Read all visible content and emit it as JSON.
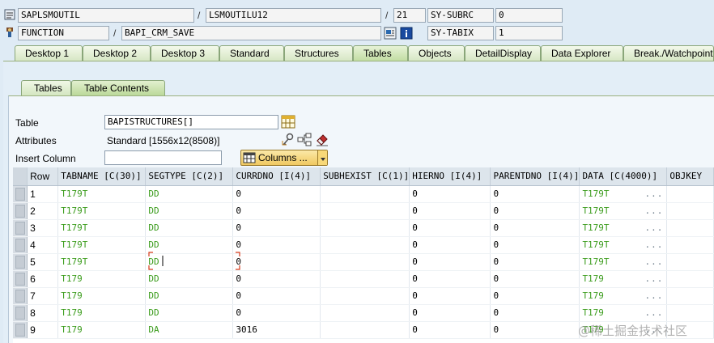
{
  "header": {
    "row1": {
      "program": "SAPLSMOUTIL",
      "include": "LSMOUTILU12",
      "line": "21",
      "sys_label": "SY-SUBRC",
      "sys_value": "0",
      "sep": "/"
    },
    "row2": {
      "type": "FUNCTION",
      "name": "BAPI_CRM_SAVE",
      "sys_label": "SY-TABIX",
      "sys_value": "1",
      "sep": "/"
    }
  },
  "main_tabs": [
    "Desktop 1",
    "Desktop 2",
    "Desktop 3",
    "Standard",
    "Structures",
    "Tables",
    "Objects",
    "DetailDisplay",
    "Data Explorer",
    "Break./Watchpoint"
  ],
  "active_main_tab": "Tables",
  "sub_tabs": [
    "Tables",
    "Table Contents"
  ],
  "active_sub_tab": "Table Contents",
  "form": {
    "table_label": "Table",
    "table_value": "BAPISTRUCTURES[]",
    "attributes_label": "Attributes",
    "attributes_value": "Standard [1556x12(8508)]",
    "insert_column_label": "Insert Column",
    "insert_column_value": "",
    "columns_button": "Columns ..."
  },
  "grid": {
    "headers": [
      "Row",
      "TABNAME [C(30)]",
      "SEGTYPE [C(2)]",
      "CURRDNO [I(4)]",
      "SUBHEXIST [C(1)]",
      "HIERNO [I(4)]",
      "PARENTDNO [I(4)]",
      "DATA [C(4000)]",
      "OBJKEY"
    ],
    "rows": [
      {
        "row": "1",
        "tabname": "T179T",
        "segtype": "DD",
        "currdno": "0",
        "subhexist": "",
        "hierno": "0",
        "parentdno": "0",
        "data": "T179T"
      },
      {
        "row": "2",
        "tabname": "T179T",
        "segtype": "DD",
        "currdno": "0",
        "subhexist": "",
        "hierno": "0",
        "parentdno": "0",
        "data": "T179T"
      },
      {
        "row": "3",
        "tabname": "T179T",
        "segtype": "DD",
        "currdno": "0",
        "subhexist": "",
        "hierno": "0",
        "parentdno": "0",
        "data": "T179T"
      },
      {
        "row": "4",
        "tabname": "T179T",
        "segtype": "DD",
        "currdno": "0",
        "subhexist": "",
        "hierno": "0",
        "parentdno": "0",
        "data": "T179T"
      },
      {
        "row": "5",
        "tabname": "T179T",
        "segtype": "DD",
        "currdno": "0",
        "subhexist": "",
        "hierno": "0",
        "parentdno": "0",
        "data": "T179T"
      },
      {
        "row": "6",
        "tabname": "T179",
        "segtype": "DD",
        "currdno": "0",
        "subhexist": "",
        "hierno": "0",
        "parentdno": "0",
        "data": "T179"
      },
      {
        "row": "7",
        "tabname": "T179",
        "segtype": "DD",
        "currdno": "0",
        "subhexist": "",
        "hierno": "0",
        "parentdno": "0",
        "data": "T179"
      },
      {
        "row": "8",
        "tabname": "T179",
        "segtype": "DD",
        "currdno": "0",
        "subhexist": "",
        "hierno": "0",
        "parentdno": "0",
        "data": "T179"
      },
      {
        "row": "9",
        "tabname": "T179",
        "segtype": "DA",
        "currdno": "3016",
        "subhexist": "",
        "hierno": "0",
        "parentdno": "0",
        "data": "T179"
      }
    ],
    "dots": "..."
  },
  "watermark": "@稀土掘金技术社区",
  "colors": {
    "background": "#dfebf5",
    "tab_green": "#d5e6c3",
    "value_green": "#3b9c1c",
    "focus_red": "#d63a1a"
  },
  "icons": [
    "program-icon",
    "function-icon",
    "display-icon",
    "info-icon",
    "table-icon",
    "key-icon",
    "structure-icon",
    "eraser-icon",
    "columns-table-icon"
  ]
}
